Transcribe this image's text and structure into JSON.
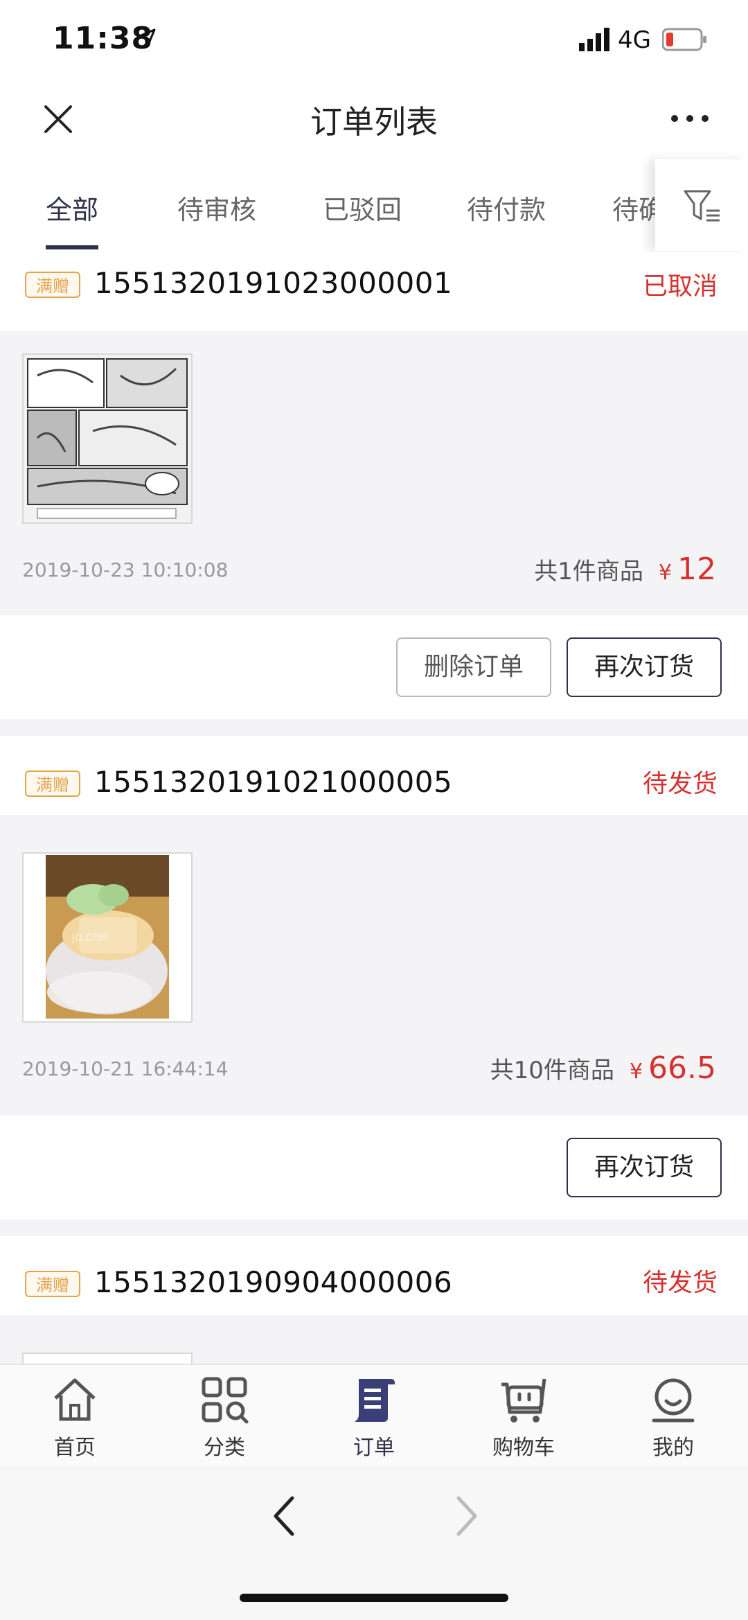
{
  "status_bar": {
    "time": "11:38",
    "network": "4G"
  },
  "header": {
    "title": "订单列表"
  },
  "tabs": [
    {
      "label": "全部",
      "active": true
    },
    {
      "label": "待审核",
      "active": false
    },
    {
      "label": "已驳回",
      "active": false
    },
    {
      "label": "待付款",
      "active": false
    },
    {
      "label": "待确",
      "active": false
    }
  ],
  "orders": [
    {
      "badge": "满赠",
      "order_no": "1551320191023000001",
      "status": "已取消",
      "date": "2019-10-23 10:10:08",
      "count": "共1件商品",
      "currency": "¥",
      "price": "12",
      "buttons": [
        "删除订单",
        "再次订货"
      ]
    },
    {
      "badge": "满赠",
      "order_no": "1551320191021000005",
      "status": "待发货",
      "date": "2019-10-21 16:44:14",
      "count": "共10件商品",
      "currency": "¥",
      "price": "66.5",
      "buttons": [
        "再次订货"
      ]
    },
    {
      "badge": "满赠",
      "order_no": "1551320190904000006",
      "status": "待发货"
    }
  ],
  "bottom_nav": [
    {
      "label": "首页",
      "icon": "home-icon"
    },
    {
      "label": "分类",
      "icon": "category-icon"
    },
    {
      "label": "订单",
      "icon": "order-icon",
      "active": true
    },
    {
      "label": "购物车",
      "icon": "cart-icon"
    },
    {
      "label": "我的",
      "icon": "profile-icon"
    }
  ],
  "colors": {
    "accent": "#2f3249",
    "price": "#d6312f",
    "badge": "#e3a44d"
  }
}
